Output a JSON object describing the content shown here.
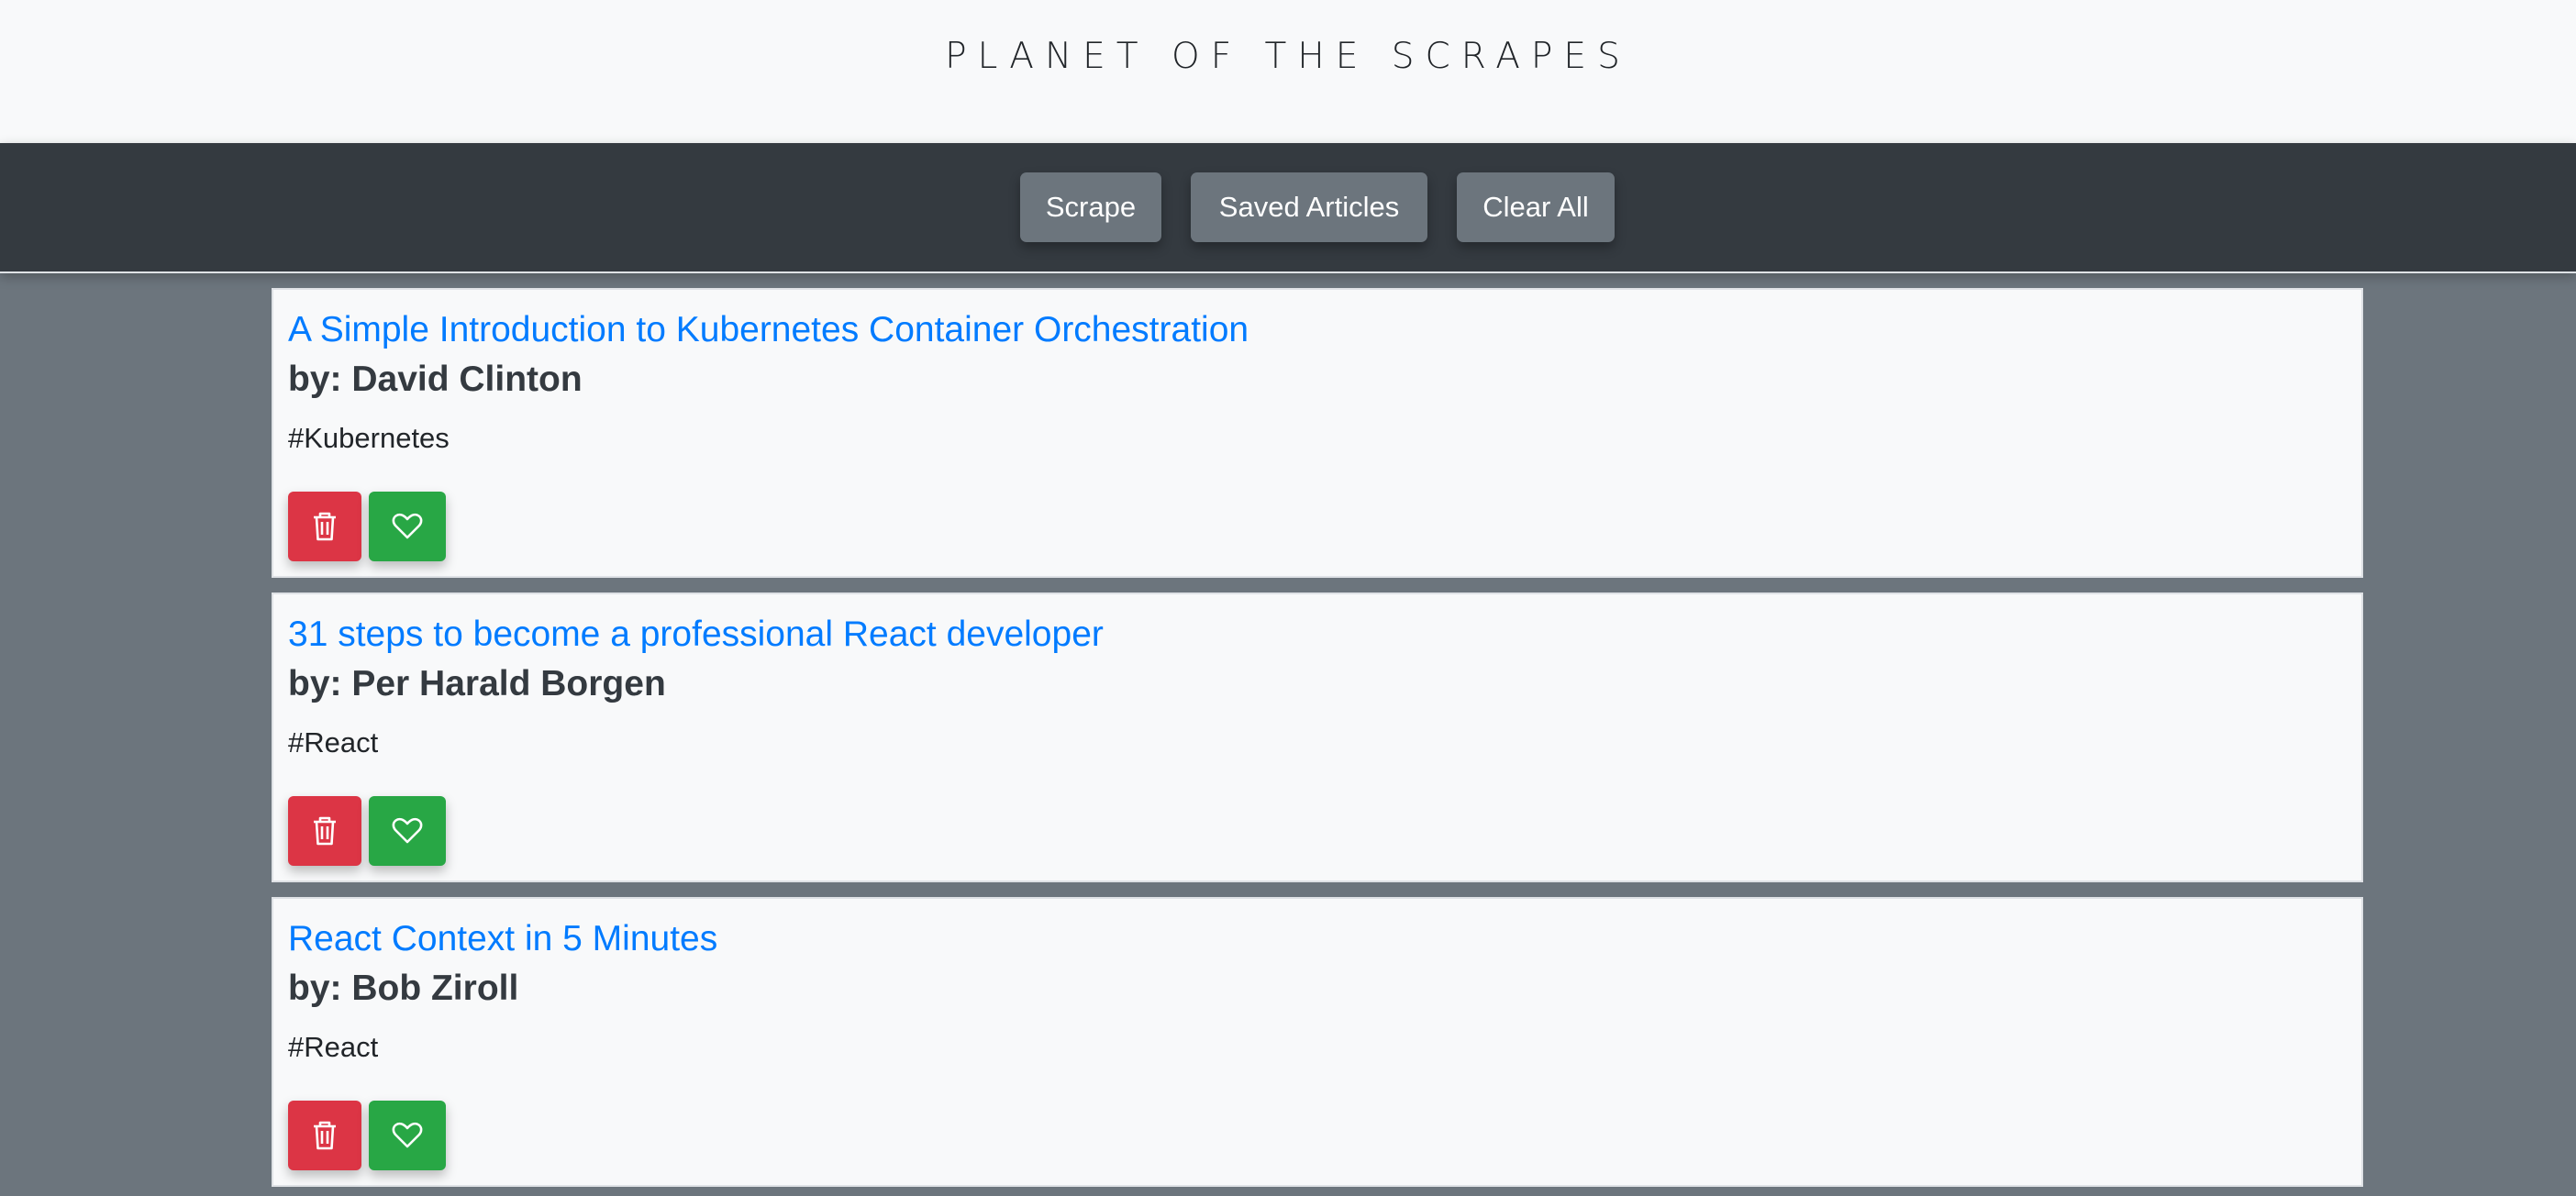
{
  "header": {
    "title": "PLANET OF THE SCRAPES"
  },
  "navbar": {
    "scrape_label": "Scrape",
    "saved_label": "Saved Articles",
    "clear_label": "Clear All"
  },
  "articles": [
    {
      "title": "A Simple Introduction to Kubernetes Container Orchestration",
      "author": "by: David Clinton",
      "tag": "#Kubernetes"
    },
    {
      "title": "31 steps to become a professional React developer",
      "author": "by: Per Harald Borgen",
      "tag": "#React"
    },
    {
      "title": "React Context in 5 Minutes",
      "author": "by: Bob Ziroll",
      "tag": "#React"
    }
  ],
  "icons": {
    "delete": "trash-icon",
    "save": "heart-icon"
  },
  "colors": {
    "link": "#007bff",
    "delete": "#dc3545",
    "save": "#28a745",
    "navbar": "#343a40",
    "nav_button": "#6c757d",
    "page_background": "#6c757d"
  }
}
